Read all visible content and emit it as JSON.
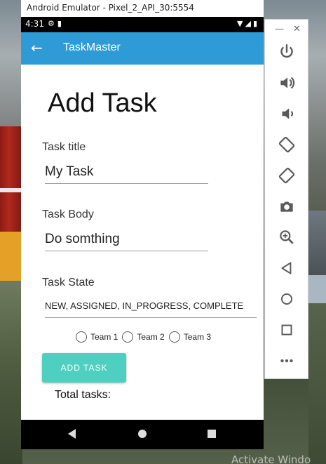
{
  "window": {
    "title": "Android Emulator - Pixel_2_API_30:5554"
  },
  "status_bar": {
    "time": "4:31"
  },
  "app_bar": {
    "title": "TaskMaster"
  },
  "page": {
    "heading": "Add Task",
    "task_title": {
      "label": "Task title",
      "value": "My Task"
    },
    "task_body": {
      "label": "Task Body",
      "value": "Do somthing"
    },
    "task_state": {
      "label": "Task State",
      "value": "NEW, ASSIGNED, IN_PROGRESS, COMPLETE"
    },
    "teams": [
      "Team 1",
      "Team 2",
      "Team 3"
    ],
    "add_button": "ADD TASK",
    "total_label": "Total tasks:"
  },
  "desktop": {
    "watermark": "Activate Windo"
  },
  "colors": {
    "app_bar": "#2f9bd6",
    "add_button": "#4fcfc0",
    "toolbar_icon": "#5a5a5a"
  },
  "toolbar_icons": [
    "power-icon",
    "volume-up-icon",
    "volume-down-icon",
    "rotate-left-icon",
    "rotate-right-icon",
    "camera-icon",
    "zoom-icon",
    "back-icon",
    "home-icon",
    "overview-icon",
    "more-icon"
  ]
}
